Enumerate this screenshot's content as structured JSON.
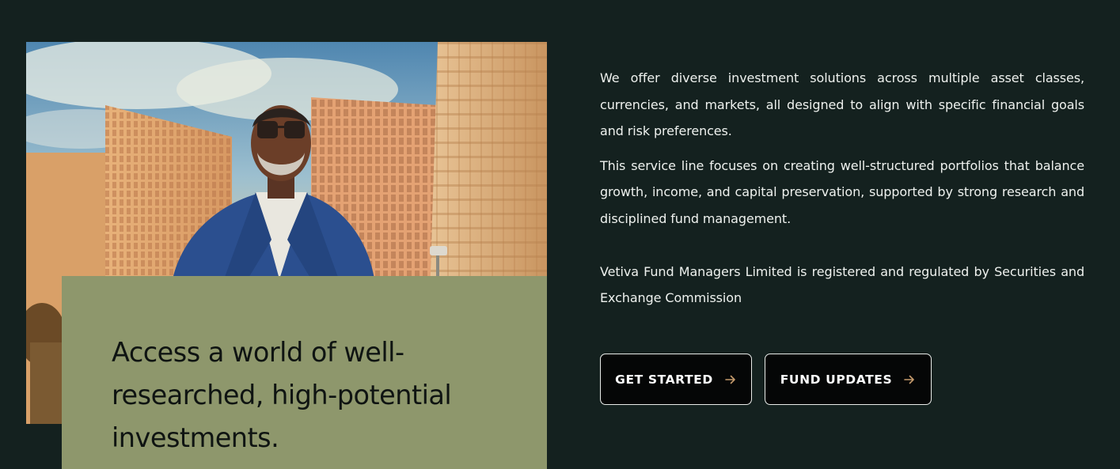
{
  "card": {
    "heading": "Access a world of well-researched, high-potential investments."
  },
  "content": {
    "paragraphs": [
      "We offer diverse investment solutions across multiple asset classes, currencies, and markets, all designed to align with specific financial goals and risk preferences.",
      "This service line focuses on creating well-structured portfolios that balance growth, income, and capital preservation, supported by strong research and disciplined fund management.",
      "Vetiva Fund Managers Limited is registered and regulated by Securities and Exchange Commission"
    ]
  },
  "buttons": {
    "get_started": "GET STARTED",
    "fund_updates": "FUND UPDATES",
    "arrow_icon": "arrow-right-icon"
  },
  "colors": {
    "background": "#14211f",
    "card": "#8e976c",
    "button_bg": "#050606",
    "button_border": "#e9ece9",
    "arrow_accent": "#c49a6c"
  }
}
